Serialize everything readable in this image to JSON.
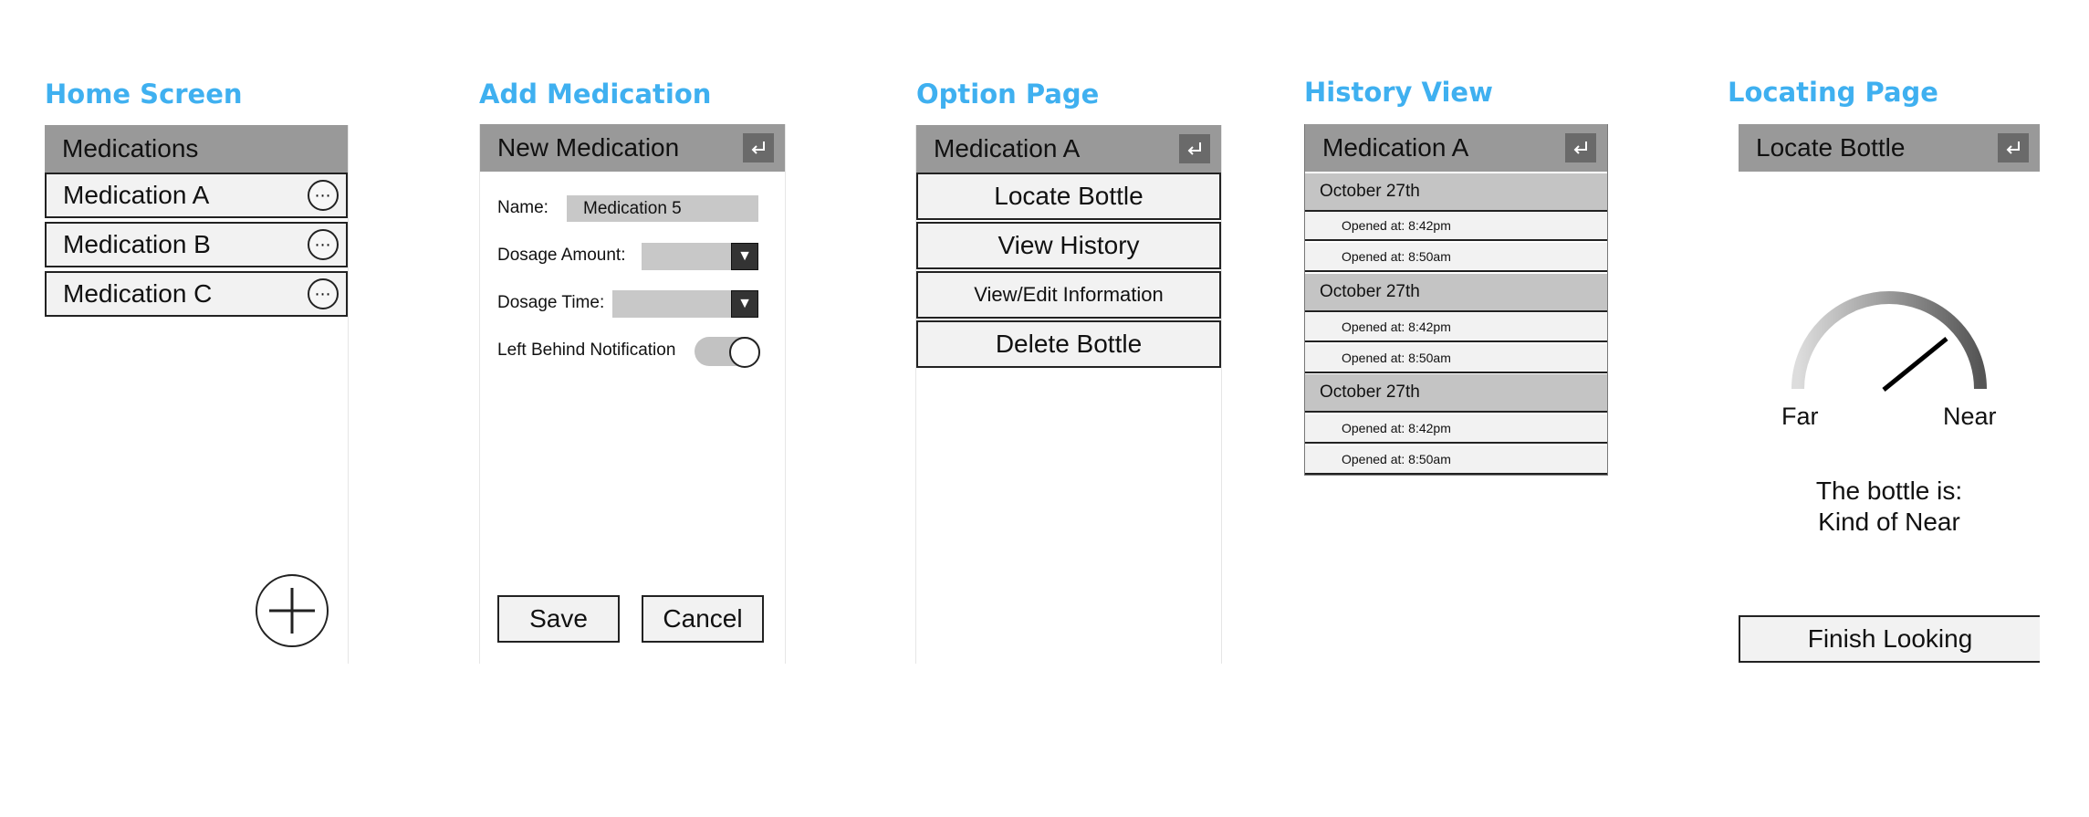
{
  "panels": {
    "home": {
      "title": "Home Screen",
      "header": "Medications",
      "items": [
        {
          "label": "Medication A",
          "icon": "more-options-icon"
        },
        {
          "label": "Medication B",
          "icon": "more-options-icon"
        },
        {
          "label": "Medication C",
          "icon": "more-options-icon"
        }
      ],
      "more_glyph": "⋯",
      "fab_icon": "plus-icon"
    },
    "add_medication": {
      "title": "Add Medication",
      "header": "New Medication",
      "name_label": "Name:",
      "name_value": "Medication 5",
      "dosage_amount_label": "Dosage Amount:",
      "dosage_time_label": "Dosage Time:",
      "left_behind_label": "Left Behind Notification",
      "dropdown_glyph": "▼",
      "save_label": "Save",
      "cancel_label": "Cancel"
    },
    "option": {
      "title": "Option Page",
      "header": "Medication A",
      "buttons": [
        "Locate Bottle",
        "View History",
        "View/Edit Information",
        "Delete Bottle"
      ]
    },
    "history": {
      "title": "History View",
      "header": "Medication A",
      "groups": [
        {
          "date": "October 27th",
          "entries": [
            "Opened at: 8:42pm",
            "Opened at: 8:50am"
          ]
        },
        {
          "date": "October 27th",
          "entries": [
            "Opened at: 8:42pm",
            "Opened at: 8:50am"
          ]
        },
        {
          "date": "October 27th",
          "entries": [
            "Opened at: 8:42pm",
            "Opened at: 8:50am"
          ]
        }
      ]
    },
    "locating": {
      "title": "Locating Page",
      "header": "Locate Bottle",
      "far_label": "Far",
      "near_label": "Near",
      "status_line1": "The bottle is:",
      "status_line2": "Kind of Near",
      "finish_label": "Finish Looking"
    }
  },
  "icons": {
    "return": "return-arrow-icon",
    "more": "more-options-icon",
    "add": "plus-icon"
  },
  "colors": {
    "title_accent": "#3fb0f0",
    "header_bg": "#999999",
    "return_btn_bg": "#6a6a6a",
    "item_bg": "#f2f2f2",
    "date_row_bg": "#c4c4c4",
    "input_bg": "#c8c8c8"
  }
}
